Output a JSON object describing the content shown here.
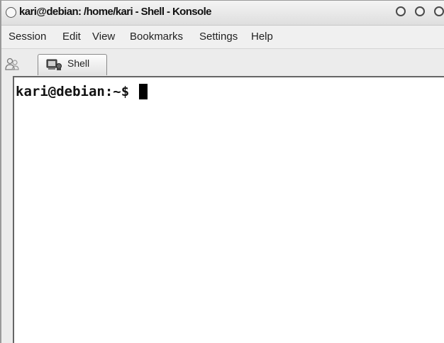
{
  "window": {
    "title": "kari@debian: /home/kari - Shell - Konsole"
  },
  "menubar": {
    "items": [
      "Session",
      "Edit",
      "View",
      "Bookmarks",
      "Settings",
      "Help"
    ]
  },
  "tabbar": {
    "new_session_icon": "new-session-icon",
    "tabs": [
      {
        "label": "Shell",
        "icon": "terminal-icon"
      }
    ]
  },
  "terminal": {
    "prompt": "kari@debian:~$ "
  }
}
